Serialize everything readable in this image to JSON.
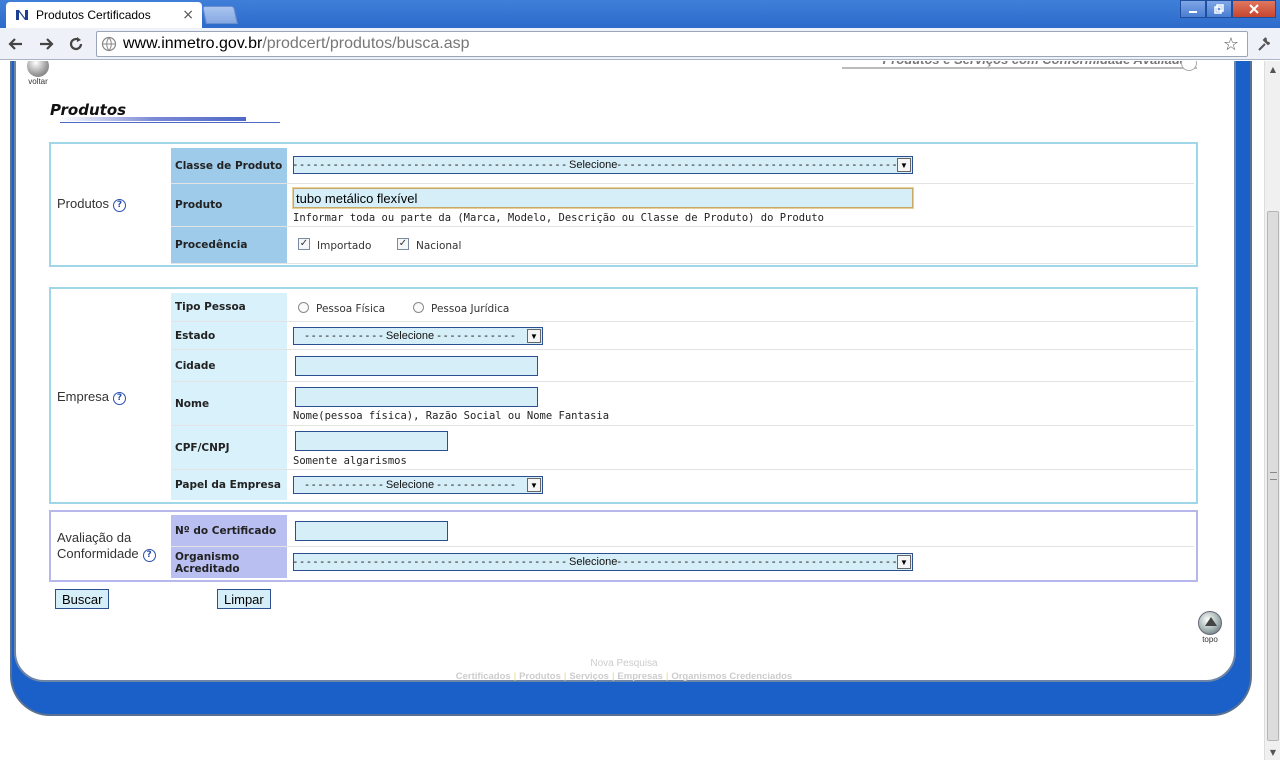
{
  "browser": {
    "tab_title": "Produtos Certificados",
    "tab_close": "×",
    "url_host": "www.inmetro.gov.br",
    "url_path": "/prodcert/produtos/busca.asp"
  },
  "page": {
    "voltar_label": "voltar",
    "header_right": "Produtos e Serviços com Conformidade Avaliada",
    "title": "Produtos",
    "topo_label": "topo"
  },
  "produtos": {
    "section_label": "Produtos",
    "help": "?",
    "classe_label": "Classe de Produto",
    "classe_value": "- - - - - - - - - - - - - - - - - - - - - - - - - - - - - - - - - - - - - - - - - - - Selecione- - - - - - - - - - - - - - - - - - - - - - - - - - - - - - - - - - - - - - - - - - - -",
    "produto_label": "Produto",
    "produto_value": "tubo metálico flexível",
    "produto_hint": "Informar toda ou parte da (Marca, Modelo, Descrição ou Classe de Produto) do Produto",
    "procedencia_label": "Procedência",
    "importado_label": "Importado",
    "nacional_label": "Nacional",
    "importado_checked": true,
    "nacional_checked": true
  },
  "empresa": {
    "section_label": "Empresa",
    "help": "?",
    "tipo_pessoa_label": "Tipo Pessoa",
    "pessoa_fisica_label": "Pessoa Física",
    "pessoa_juridica_label": "Pessoa Jurídica",
    "estado_label": "Estado",
    "estado_value": "- - - - - - - - - - - - Selecione - - - - - - - - - - - -",
    "cidade_label": "Cidade",
    "cidade_value": "",
    "nome_label": "Nome",
    "nome_value": "",
    "nome_hint": "Nome(pessoa física), Razão Social ou Nome Fantasia",
    "cpf_label": "CPF/CNPJ",
    "cpf_value": "",
    "cpf_hint": "Somente algarismos",
    "papel_label": "Papel da Empresa",
    "papel_value": "- - - - - - - - - - - - Selecione - - - - - - - - - - - -"
  },
  "avaliacao": {
    "section_label_line1": "Avaliação da",
    "section_label_line2": "Conformidade",
    "help": "?",
    "certificado_label": "Nº do Certificado",
    "certificado_value": "",
    "organismo_label": "Organismo Acreditado",
    "organismo_value": "- - - - - - - - - - - - - - - - - - - - - - - - - - - - - - - - - - - - - - - - - - - Selecione- - - - - - - - - - - - - - - - - - - - - - - - - - - - - - - - - - - - - - - - - - - -"
  },
  "actions": {
    "buscar": "Buscar",
    "limpar": "Limpar"
  },
  "footer": {
    "title": "Nova Pesquisa",
    "links": [
      "Certificados",
      "Produtos",
      "Serviços",
      "Empresas",
      "Organismos Credenciados"
    ]
  }
}
